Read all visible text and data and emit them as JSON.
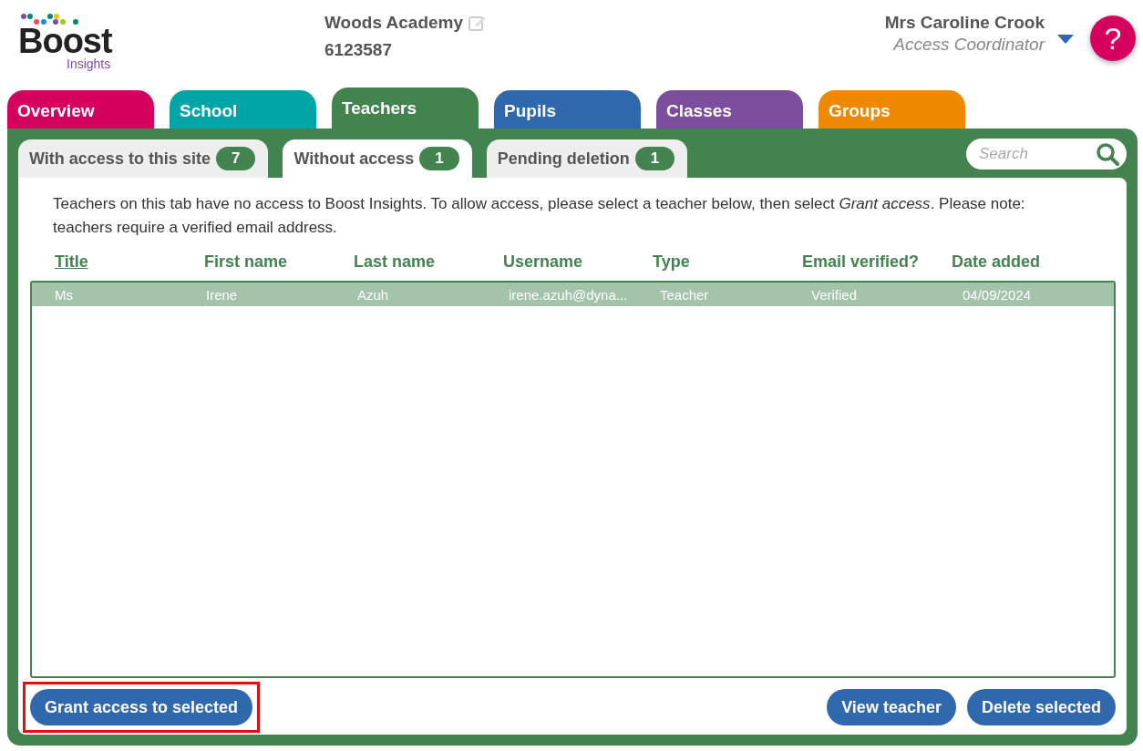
{
  "header": {
    "logo": {
      "word": "Boost",
      "subword": "Insights"
    },
    "school_name": "Woods Academy",
    "school_number": "6123587",
    "user_name": "Mrs Caroline Crook",
    "user_role": "Access Coordinator",
    "help": "?"
  },
  "tabs": [
    {
      "label": "Overview",
      "color": "#d6005f",
      "selected": false
    },
    {
      "label": "School",
      "color": "#00a5a5",
      "selected": false
    },
    {
      "label": "Teachers",
      "color": "#43834f",
      "selected": true
    },
    {
      "label": "Pupils",
      "color": "#3068ad",
      "selected": false
    },
    {
      "label": "Classes",
      "color": "#7b4f9e",
      "selected": false
    },
    {
      "label": "Groups",
      "color": "#ef8a00",
      "selected": false
    }
  ],
  "subtabs": [
    {
      "label": "With access to this site",
      "count": "7",
      "selected": false
    },
    {
      "label": "Without access",
      "count": "1",
      "selected": true
    },
    {
      "label": "Pending deletion",
      "count": "1",
      "selected": false
    }
  ],
  "search": {
    "placeholder": "Search"
  },
  "intro": "Teachers on this tab have no access to Boost Insights. To allow access, please select a teacher below, then select *Grant access*. Please note: teachers require a verified email address.",
  "table": {
    "columns": [
      {
        "label": "Title",
        "sorted": true
      },
      {
        "label": "First name",
        "sorted": false
      },
      {
        "label": "Last name",
        "sorted": false
      },
      {
        "label": "Username",
        "sorted": false
      },
      {
        "label": "Type",
        "sorted": false
      },
      {
        "label": "Email verified?",
        "sorted": false
      },
      {
        "label": "Date added",
        "sorted": false
      }
    ],
    "rows": [
      {
        "cells": [
          "Ms",
          "Irene",
          "Azuh",
          "irene.azuh@dyna...",
          "Teacher",
          "Verified",
          "04/09/2024"
        ],
        "selected": true
      }
    ]
  },
  "buttons": [
    {
      "label": "Grant access to selected",
      "highlighted": true
    },
    {
      "label": "View teacher",
      "highlighted": false
    },
    {
      "label": "Delete selected",
      "highlighted": false
    }
  ]
}
